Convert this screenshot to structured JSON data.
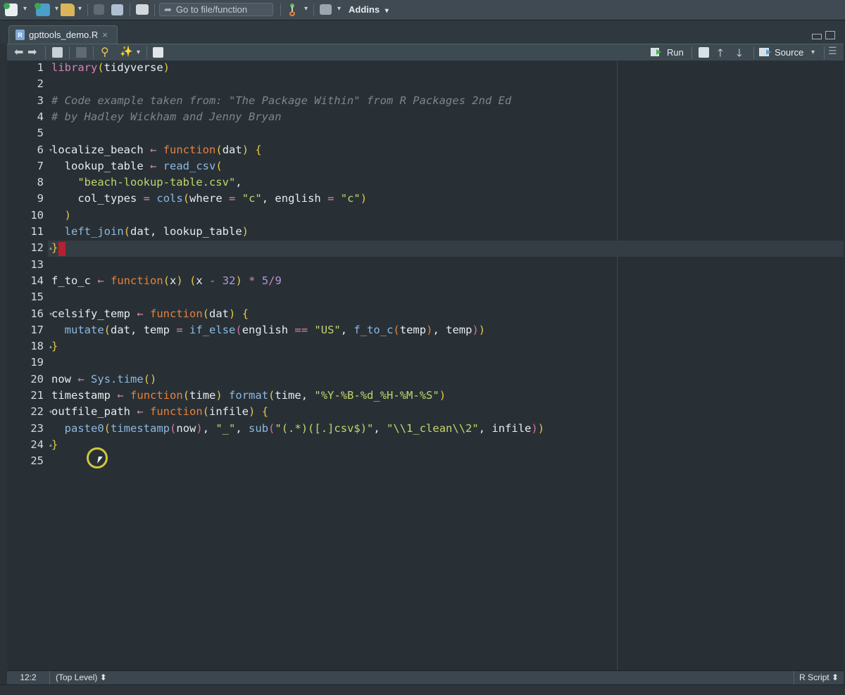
{
  "toolbar": {
    "goto_placeholder": "Go to file/function",
    "addins_label": "Addins",
    "addins_caret": "▾"
  },
  "tab": {
    "file_name": "gpttools_demo.R",
    "close": "×",
    "file_badge": "R"
  },
  "editor_toolbar": {
    "run_label": "Run",
    "source_label": "Source",
    "source_caret": "▾"
  },
  "editor": {
    "line_numbers": [
      "1",
      "2",
      "3",
      "4",
      "5",
      "6",
      "7",
      "8",
      "9",
      "10",
      "11",
      "12",
      "13",
      "14",
      "15",
      "16",
      "17",
      "18",
      "19",
      "20",
      "21",
      "22",
      "23",
      "24",
      "25"
    ],
    "lines": [
      "library(tidyverse)",
      "",
      "# Code example taken from: \"The Package Within\" from R Packages 2nd Ed",
      "# by Hadley Wickham and Jenny Bryan",
      "",
      "localize_beach ← function(dat) {",
      "  lookup_table ← read_csv(",
      "    \"beach-lookup-table.csv\",",
      "    col_types = cols(where = \"c\", english = \"c\")",
      "  )",
      "  left_join(dat, lookup_table)",
      "}",
      "",
      "f_to_c ← function(x) (x - 32) * 5/9",
      "",
      "celsify_temp ← function(dat) {",
      "  mutate(dat, temp = if_else(english == \"US\", f_to_c(temp), temp))",
      "}",
      "",
      "now ← Sys.time()",
      "timestamp ← function(time) format(time, \"%Y-%B-%d_%H-%M-%S\")",
      "outfile_path ← function(infile) {",
      "  paste0(timestamp(now), \"_\", sub(\"(.*)([.]csv$)\", \"\\\\1_clean\\\\2\", infile))",
      "}",
      ""
    ],
    "fold_markers": {
      "6": "▾",
      "12": "▴",
      "16": "▾",
      "18": "▴",
      "22": "▾",
      "24": "▴"
    }
  },
  "status_bar": {
    "position": "12:2",
    "scope": "(Top Level) ⬍",
    "file_type": "R Script ⬍"
  },
  "icons": [
    "new-file-icon",
    "new-project-icon",
    "open-folder-icon",
    "save-icon",
    "save-all-icon",
    "print-icon",
    "goto-arrow-icon",
    "git-icon",
    "grid-icon",
    "back-icon",
    "forward-icon",
    "show-in-window-icon",
    "find-icon",
    "wand-icon",
    "compile-report-icon",
    "run-icon",
    "rerun-icon",
    "arrow-up-icon",
    "arrow-down-icon",
    "source-icon",
    "outline-icon"
  ]
}
